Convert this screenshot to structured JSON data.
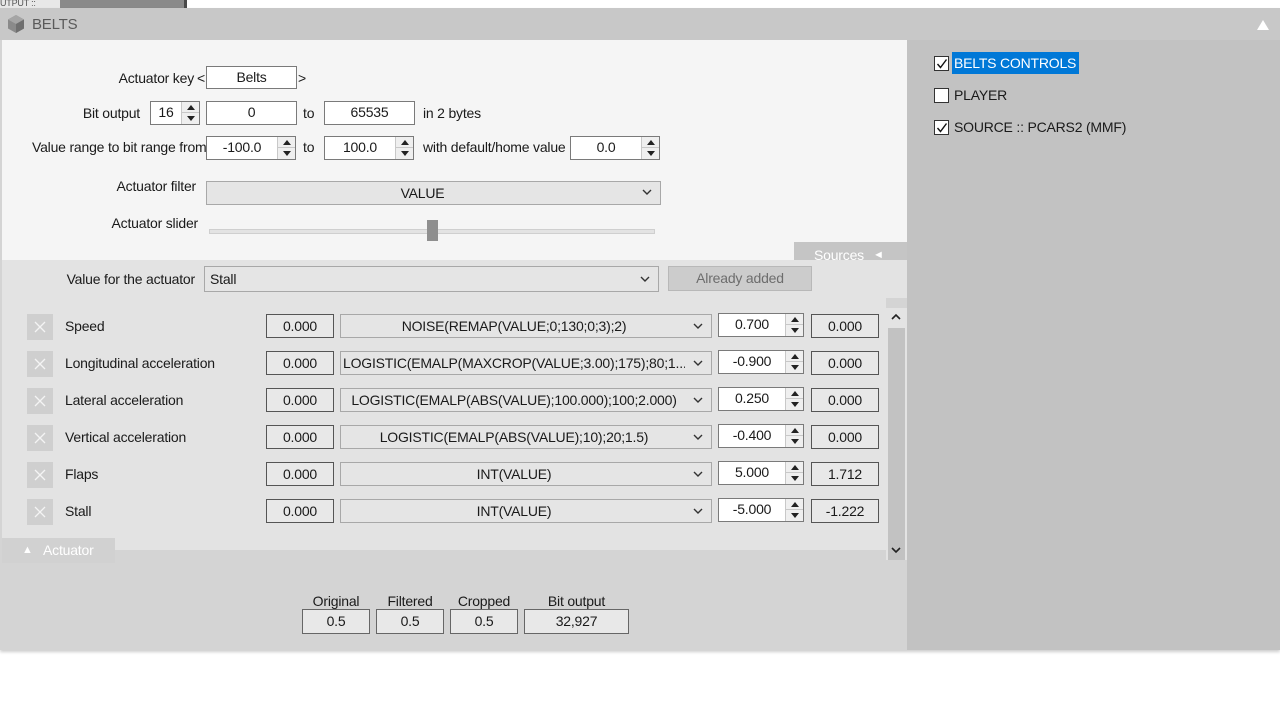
{
  "top_tab": {
    "label": "UTPUT ::"
  },
  "window": {
    "title": "BELTS"
  },
  "config": {
    "actuator_key_label": "Actuator key",
    "actuator_key_prev": "<",
    "actuator_key_value": "Belts",
    "actuator_key_next": ">",
    "bit_output_label": "Bit output",
    "bit_output_value": "16",
    "bit_min": "0",
    "to_label": "to",
    "bit_max": "65535",
    "bytes_label": "in 2 bytes",
    "range_label": "Value range to bit range from",
    "range_min": "-100.0",
    "range_max": "100.0",
    "default_label": "with default/home value",
    "default_value": "0.0",
    "filter_label": "Actuator filter",
    "filter_value": "VALUE",
    "slider_label": "Actuator slider",
    "slider_position": 0.5
  },
  "sources_tab": {
    "label": "Sources",
    "arrow": "◄"
  },
  "value_row": {
    "label": "Value for the actuator",
    "selected": "Stall",
    "add_button": "Already added"
  },
  "rows": [
    {
      "name": "Speed",
      "original": "0.000",
      "function": "NOISE(REMAP(VALUE;0;130;0;3);2)",
      "weight": "0.700",
      "output": "0.000"
    },
    {
      "name": "Longitudinal acceleration",
      "original": "0.000",
      "function": "LOGISTIC(EMALP(MAXCROP(VALUE;3.00);175);80;1...",
      "weight": "-0.900",
      "output": "0.000"
    },
    {
      "name": "Lateral acceleration",
      "original": "0.000",
      "function": "LOGISTIC(EMALP(ABS(VALUE);100.000);100;2.000)",
      "weight": "0.250",
      "output": "0.000"
    },
    {
      "name": "Vertical acceleration",
      "original": "0.000",
      "function": "LOGISTIC(EMALP(ABS(VALUE);10);20;1.5)",
      "weight": "-0.400",
      "output": "0.000"
    },
    {
      "name": "Flaps",
      "original": "0.000",
      "function": "INT(VALUE)",
      "weight": "5.000",
      "output": "1.712"
    },
    {
      "name": "Stall",
      "original": "0.000",
      "function": "INT(VALUE)",
      "weight": "-5.000",
      "output": "-1.222"
    }
  ],
  "actuator_tab": {
    "label": "Actuator",
    "arrow": "▲"
  },
  "stats": {
    "original_label": "Original",
    "original_value": "0.5",
    "filtered_label": "Filtered",
    "filtered_value": "0.5",
    "cropped_label": "Cropped",
    "cropped_value": "0.5",
    "bit_output_label": "Bit output",
    "bit_output_value": "32,927"
  },
  "right_panel": {
    "items": [
      {
        "label": "BELTS CONTROLS",
        "checked": true,
        "selected": true
      },
      {
        "label": "PLAYER",
        "checked": false,
        "selected": false
      },
      {
        "label": "SOURCE :: PCARS2 (MMF)",
        "checked": true,
        "selected": false
      }
    ]
  },
  "colors": {
    "selection": "#0078d7",
    "panel": "#c2c2c2",
    "config_bg": "#f5f5f5"
  }
}
